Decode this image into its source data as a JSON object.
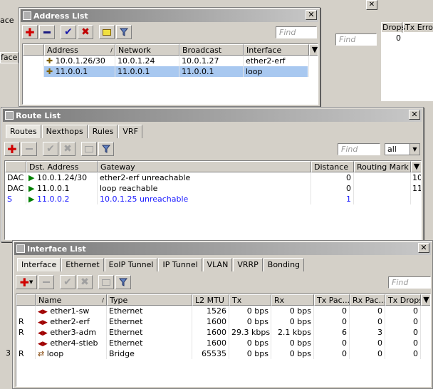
{
  "background": {
    "left_tab_labels": [
      "ace",
      "face"
    ],
    "right_headers": [
      "Drops",
      "Tx Errors"
    ],
    "right_value": "0",
    "right_close": "✕",
    "find_placeholder": "Find",
    "bottom_left": "3"
  },
  "address_list": {
    "title": "Address List",
    "find_placeholder": "Find",
    "columns": [
      "Address",
      "Network",
      "Broadcast",
      "Interface"
    ],
    "rows": [
      {
        "address": "10.0.1.26/30",
        "network": "10.0.1.24",
        "broadcast": "10.0.1.27",
        "interface": "ether2-erf",
        "selected": false
      },
      {
        "address": "11.0.0.1",
        "network": "11.0.0.1",
        "broadcast": "11.0.0.1",
        "interface": "loop",
        "selected": true
      }
    ]
  },
  "route_list": {
    "title": "Route List",
    "tabs": [
      "Routes",
      "Nexthops",
      "Rules",
      "VRF"
    ],
    "find_placeholder": "Find",
    "filter_value": "all",
    "columns": [
      "Dst. Address",
      "Gateway",
      "Distance",
      "Routing Mark"
    ],
    "rows": [
      {
        "flag": "DAC",
        "dst": "10.0.1.24/30",
        "gateway": "ether2-erf unreachable",
        "distance": "0",
        "extra": "10",
        "blue": false
      },
      {
        "flag": "DAC",
        "dst": "11.0.0.1",
        "gateway": "loop reachable",
        "distance": "0",
        "extra": "11",
        "blue": false
      },
      {
        "flag": "S",
        "dst": "11.0.0.2",
        "gateway": "10.0.1.25 unreachable",
        "distance": "1",
        "extra": "",
        "blue": true
      }
    ]
  },
  "interface_list": {
    "title": "Interface List",
    "tabs": [
      "Interface",
      "Ethernet",
      "EoIP Tunnel",
      "IP Tunnel",
      "VLAN",
      "VRRP",
      "Bonding"
    ],
    "find_placeholder": "Find",
    "columns": [
      "Name",
      "Type",
      "L2 MTU",
      "Tx",
      "Rx",
      "Tx Pac...",
      "Rx Pac...",
      "Tx Drops"
    ],
    "rows": [
      {
        "flag": "",
        "name": "ether1-sw",
        "type": "Ethernet",
        "mtu": "1526",
        "tx": "0 bps",
        "rx": "0 bps",
        "txp": "0",
        "rxp": "0",
        "txd": "0"
      },
      {
        "flag": "R",
        "name": "ether2-erf",
        "type": "Ethernet",
        "mtu": "1600",
        "tx": "0 bps",
        "rx": "0 bps",
        "txp": "0",
        "rxp": "0",
        "txd": "0"
      },
      {
        "flag": "R",
        "name": "ether3-adm",
        "type": "Ethernet",
        "mtu": "1600",
        "tx": "29.3 kbps",
        "rx": "2.1 kbps",
        "txp": "6",
        "rxp": "3",
        "txd": "0"
      },
      {
        "flag": "",
        "name": "ether4-stieb",
        "type": "Ethernet",
        "mtu": "1600",
        "tx": "0 bps",
        "rx": "0 bps",
        "txp": "0",
        "rxp": "0",
        "txd": "0"
      },
      {
        "flag": "R",
        "name": "loop",
        "type": "Bridge",
        "mtu": "65535",
        "tx": "0 bps",
        "rx": "0 bps",
        "txp": "0",
        "rxp": "0",
        "txd": "0"
      }
    ]
  },
  "icons": {
    "add": "plus-icon",
    "remove": "minus-icon",
    "enable": "check-icon",
    "disable": "x-icon",
    "comment": "note-icon",
    "filter": "funnel-icon"
  },
  "colors": {
    "selection": "#a8c8f0",
    "static_route": "#1a1aff",
    "add": "#d00000"
  }
}
